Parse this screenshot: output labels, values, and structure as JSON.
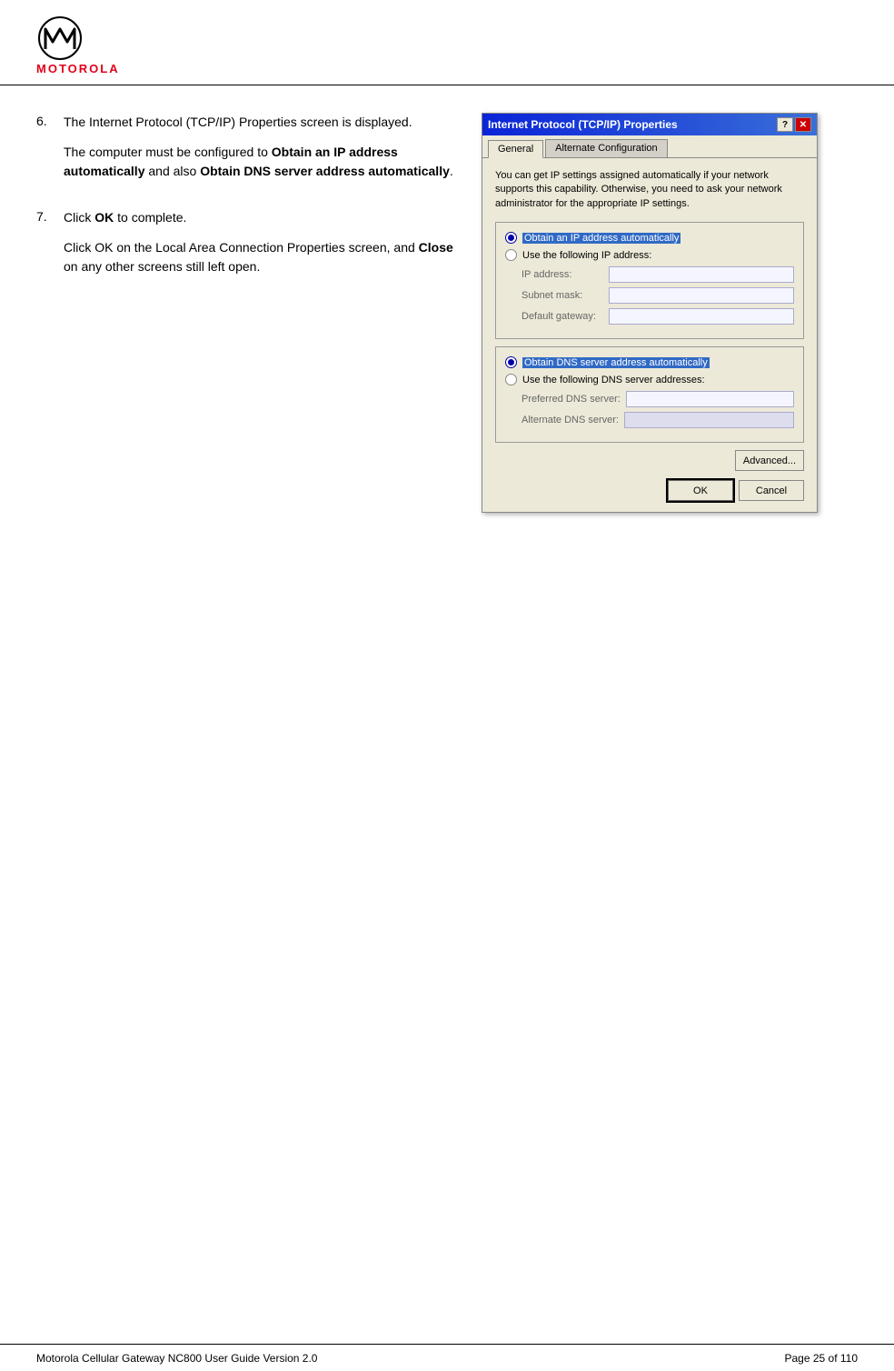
{
  "header": {
    "logo_alt": "Motorola Logo",
    "logo_text": "MOTOROLA"
  },
  "footer": {
    "left_text": "Motorola Cellular Gateway NC800 User Guide Version 2.0",
    "right_text": "Page 25 of 110"
  },
  "content": {
    "step6": {
      "number": "6.",
      "para1": "The Internet Protocol (TCP/IP) Properties screen is displayed.",
      "para2_prefix": "The computer must be configured to ",
      "para2_bold1": "Obtain an IP address automatically",
      "para2_mid": " and also ",
      "para2_bold2": "Obtain DNS server address automatically",
      "para2_suffix": "."
    },
    "step7": {
      "number": "7.",
      "para1_prefix": "Click ",
      "para1_bold": "OK",
      "para1_suffix": " to complete.",
      "para2_prefix": "Click OK on the Local Area Connection Properties screen, and ",
      "para2_bold": "Close",
      "para2_suffix": " on any other screens still left open."
    }
  },
  "dialog": {
    "title": "Internet Protocol (TCP/IP) Properties",
    "tabs": [
      {
        "label": "General",
        "active": true
      },
      {
        "label": "Alternate Configuration",
        "active": false
      }
    ],
    "description": "You can get IP settings assigned automatically if your network supports this capability. Otherwise, you need to ask your network administrator for the appropriate IP settings.",
    "section1": {
      "radio1_label": "Obtain an IP address automatically",
      "radio1_selected": true,
      "radio2_label": "Use the following IP address:",
      "radio2_selected": false,
      "fields": [
        {
          "label": "IP address:",
          "value": ""
        },
        {
          "label": "Subnet mask:",
          "value": ""
        },
        {
          "label": "Default gateway:",
          "value": ""
        }
      ]
    },
    "section2": {
      "radio1_label": "Obtain DNS server address automatically",
      "radio1_selected": true,
      "radio2_label": "Use the following DNS server addresses:",
      "radio2_selected": false,
      "fields": [
        {
          "label": "Preferred DNS server:",
          "value": ""
        },
        {
          "label": "Alternate DNS server:",
          "value": ""
        }
      ]
    },
    "advanced_btn": "Advanced...",
    "ok_btn": "OK",
    "cancel_btn": "Cancel"
  }
}
